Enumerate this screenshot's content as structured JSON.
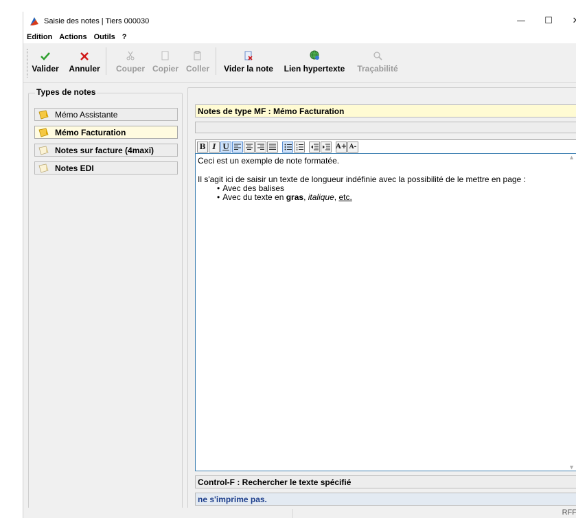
{
  "window": {
    "title": "Saisie des notes | Tiers 000030",
    "minimize": "—",
    "maximize": "☐",
    "close": "✕"
  },
  "menu": [
    "Edition",
    "Actions",
    "Outils",
    "?"
  ],
  "toolbar": {
    "validate": "Valider",
    "cancel": "Annuler",
    "cut": "Couper",
    "copy": "Copier",
    "paste": "Coller",
    "clear_note": "Vider la note",
    "hyperlink": "Lien hypertexte",
    "traceability": "Traçabilité"
  },
  "left": {
    "group_title": "Types de notes",
    "items": [
      {
        "label": "Mémo Assistante",
        "bold": false,
        "selected": false
      },
      {
        "label": "Mémo Facturation",
        "bold": true,
        "selected": true
      },
      {
        "label": "Notes sur facture (4maxi)",
        "bold": true,
        "selected": false
      },
      {
        "label": "Notes EDI",
        "bold": true,
        "selected": false
      }
    ]
  },
  "note_header": "Notes de type MF : Mémo Facturation",
  "format_toolbar": [
    "B",
    "I",
    "U",
    "align-left",
    "align-center",
    "align-right",
    "justify",
    "bullet-list",
    "numbered-list",
    "outdent",
    "indent",
    "A+",
    "A-"
  ],
  "editor": {
    "line1": "Ceci est un exemple de note formatée.",
    "line2": "Il s'agit ici de saisir un texte de longueur indéfinie avec la possibilité de le mettre en page :",
    "bullet1": "Avec des balises",
    "bullet2_prefix": "Avec du texte en ",
    "bullet2_bold": "gras",
    "bullet2_sep1": ", ",
    "bullet2_italic": "italique",
    "bullet2_sep2": ", ",
    "bullet2_underline": "etc."
  },
  "search_hint": "Control-F : Rechercher le texte spécifié",
  "print_hint": "ne s'imprime pas.",
  "status_right": "RFF",
  "colors": {
    "validate": "#2e9e2e",
    "cancel": "#d01818",
    "header_bg": "#fffbd3",
    "print_text": "#1e3f8c"
  }
}
